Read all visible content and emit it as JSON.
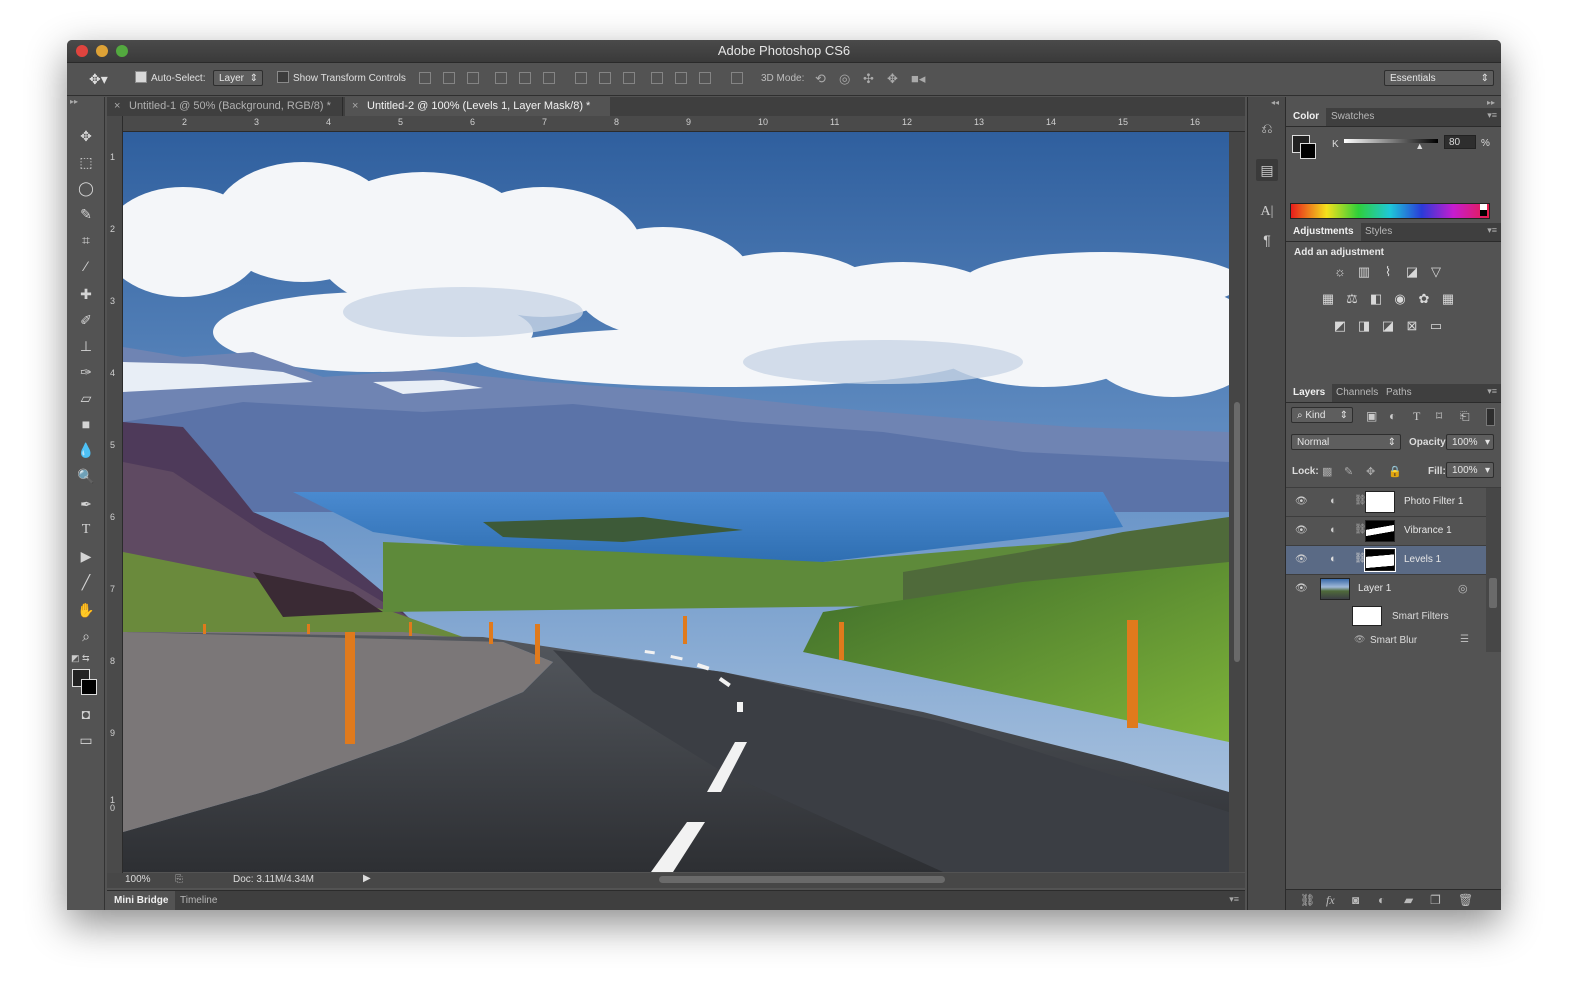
{
  "window": {
    "title": "Adobe Photoshop CS6"
  },
  "options_bar": {
    "auto_select_label": "Auto-Select:",
    "auto_select_value": "Layer",
    "show_transform_label": "Show Transform Controls",
    "mode_3d_label": "3D Mode:",
    "workspace": "Essentials"
  },
  "doc_tabs": [
    {
      "label": "Untitled-1 @ 50% (Background, RGB/8) *",
      "active": false
    },
    {
      "label": "Untitled-2 @ 100% (Levels 1, Layer Mask/8) *",
      "active": true
    }
  ],
  "ruler": {
    "top": [
      "2",
      "3",
      "4",
      "5",
      "6",
      "7",
      "8",
      "9",
      "10",
      "11",
      "12",
      "13",
      "14",
      "15",
      "16"
    ],
    "left": [
      "1",
      "2",
      "3",
      "4",
      "5",
      "6",
      "7",
      "8",
      "9",
      "1\n0"
    ]
  },
  "status": {
    "zoom": "100%",
    "doc_info": "Doc: 3.11M/4.34M"
  },
  "bottom_tabs": [
    "Mini Bridge",
    "Timeline"
  ],
  "color_panel": {
    "tabs": [
      "Color",
      "Swatches"
    ],
    "channel_label": "K",
    "value": "80",
    "unit": "%",
    "level": 0.8
  },
  "adjustments_panel": {
    "tabs": [
      "Adjustments",
      "Styles"
    ],
    "heading": "Add an adjustment",
    "icons_row1": [
      "brightness-contrast",
      "levels",
      "curves",
      "exposure",
      "vibrance"
    ],
    "icons_row2": [
      "hue-saturation",
      "color-balance",
      "black-white",
      "photo-filter",
      "channel-mixer",
      "color-lookup"
    ],
    "icons_row3": [
      "invert",
      "posterize",
      "threshold",
      "selective-color",
      "gradient-map"
    ]
  },
  "layers_panel": {
    "tabs": [
      "Layers",
      "Channels",
      "Paths"
    ],
    "filter_kind": "Kind",
    "blend_mode": "Normal",
    "opacity_label": "Opacity:",
    "opacity_value": "100%",
    "lock_label": "Lock:",
    "fill_label": "Fill:",
    "fill_value": "100%",
    "layers": [
      {
        "name": "Photo Filter 1",
        "selected": false
      },
      {
        "name": "Vibrance 1",
        "selected": false
      },
      {
        "name": "Levels 1",
        "selected": true
      },
      {
        "name": "Layer 1",
        "selected": false
      }
    ],
    "smart_filters_label": "Smart Filters",
    "smart_blur_label": "Smart Blur"
  },
  "colors": {
    "ui_bg": "#535353",
    "panel_dark": "#3f3f3f",
    "selection": "#5a6a85",
    "sky_top": "#2f5f9e",
    "road": "#3b3d40",
    "grass": "#5e8f2b"
  }
}
